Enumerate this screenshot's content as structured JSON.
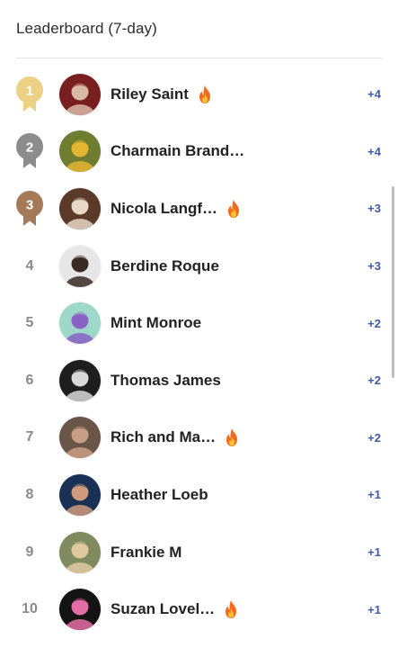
{
  "header": {
    "title": "Leaderboard (7-day)"
  },
  "colors": {
    "gold": "#ecd083",
    "silver": "#8c8c8c",
    "bronze": "#a57a58",
    "delta": "#3f5aa8"
  },
  "entries": [
    {
      "rank": "1",
      "name": "Riley Saint",
      "delta": "+4",
      "streak": true,
      "avatar_colors": [
        "#7a1f1f",
        "#d9b8a6"
      ]
    },
    {
      "rank": "2",
      "name": "Charmain Brand…",
      "delta": "+4",
      "streak": false,
      "avatar_colors": [
        "#6e7d2f",
        "#e4b531"
      ]
    },
    {
      "rank": "3",
      "name": "Nicola Langf…",
      "delta": "+3",
      "streak": true,
      "avatar_colors": [
        "#5b3a2a",
        "#e9d7c6"
      ]
    },
    {
      "rank": "4",
      "name": "Berdine Roque",
      "delta": "+3",
      "streak": false,
      "avatar_colors": [
        "#e6e6e6",
        "#3a2a24"
      ]
    },
    {
      "rank": "5",
      "name": "Mint Monroe",
      "delta": "+2",
      "streak": false,
      "avatar_colors": [
        "#9ed8c9",
        "#8a61c4"
      ]
    },
    {
      "rank": "6",
      "name": "Thomas James",
      "delta": "+2",
      "streak": false,
      "avatar_colors": [
        "#1e1e1e",
        "#d8d8d8"
      ]
    },
    {
      "rank": "7",
      "name": "Rich and Ma…",
      "delta": "+2",
      "streak": true,
      "avatar_colors": [
        "#6a5648",
        "#c99e86"
      ]
    },
    {
      "rank": "8",
      "name": "Heather Loeb",
      "delta": "+1",
      "streak": false,
      "avatar_colors": [
        "#1a3156",
        "#d09b7c"
      ]
    },
    {
      "rank": "9",
      "name": "Frankie M",
      "delta": "+1",
      "streak": false,
      "avatar_colors": [
        "#7f8a5e",
        "#e0c9a1"
      ]
    },
    {
      "rank": "10",
      "name": "Suzan Lovel…",
      "delta": "+1",
      "streak": true,
      "avatar_colors": [
        "#141414",
        "#e46da6"
      ]
    }
  ]
}
